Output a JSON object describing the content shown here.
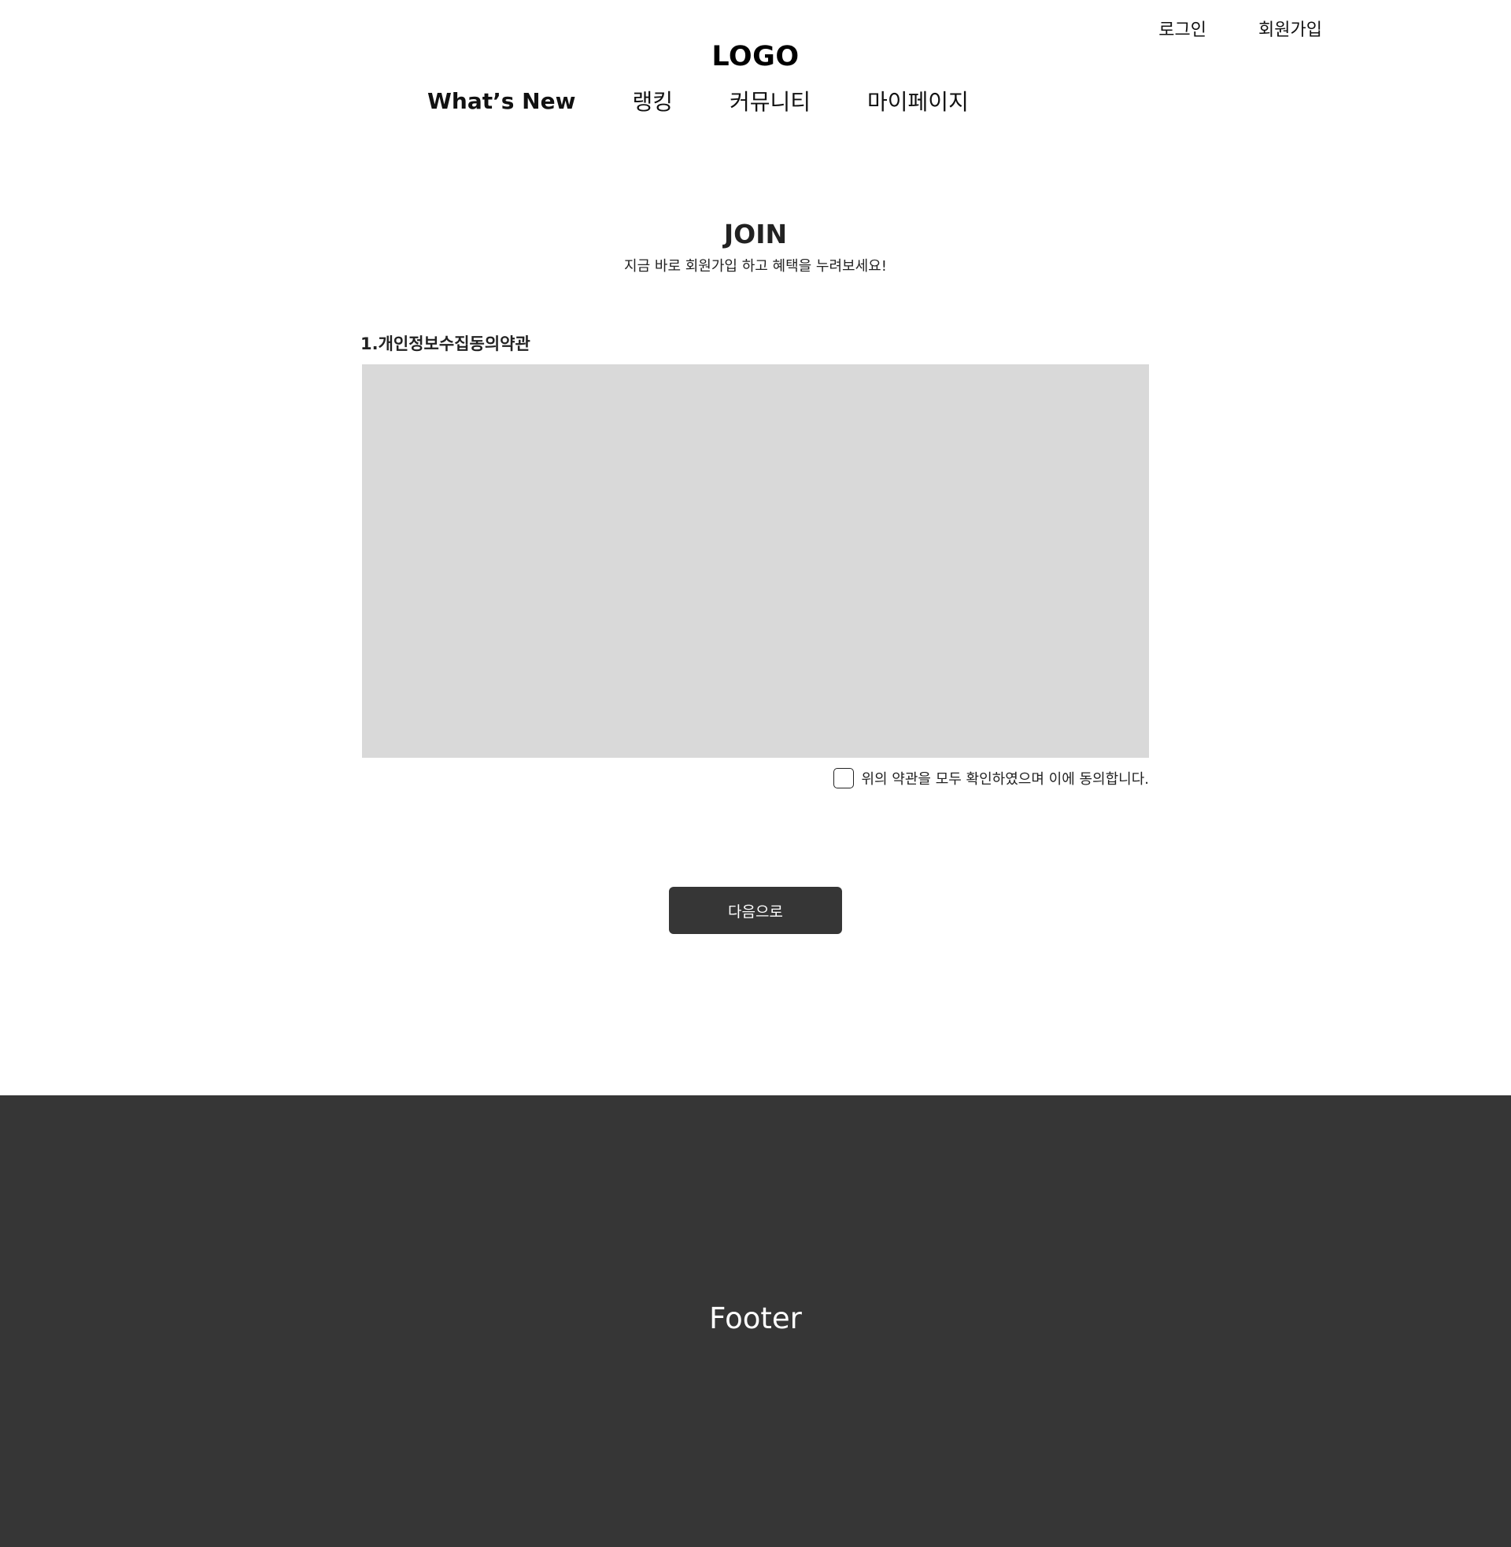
{
  "header": {
    "top_links": {
      "login": "로그인",
      "signup": "회원가입"
    },
    "logo": "LOGO",
    "nav": [
      {
        "label": "What’s New",
        "active": true
      },
      {
        "label": "랭킹",
        "active": false
      },
      {
        "label": "커뮤니티",
        "active": false
      },
      {
        "label": "마이페이지",
        "active": false
      }
    ]
  },
  "join": {
    "title": "JOIN",
    "subtitle": "지금 바로 회원가입 하고 혜택을 누려보세요!",
    "terms_heading": "1.개인정보수집동의약관",
    "terms_content": "",
    "agree_label": "위의 약관을 모두 확인하였으며 이에 동의합니다.",
    "agree_checked": false,
    "next_button": "다음으로"
  },
  "footer": {
    "text": "Footer"
  },
  "colors": {
    "footer_bg": "#363636",
    "button_bg": "#363636",
    "terms_box_bg": "#d9d9d9"
  }
}
